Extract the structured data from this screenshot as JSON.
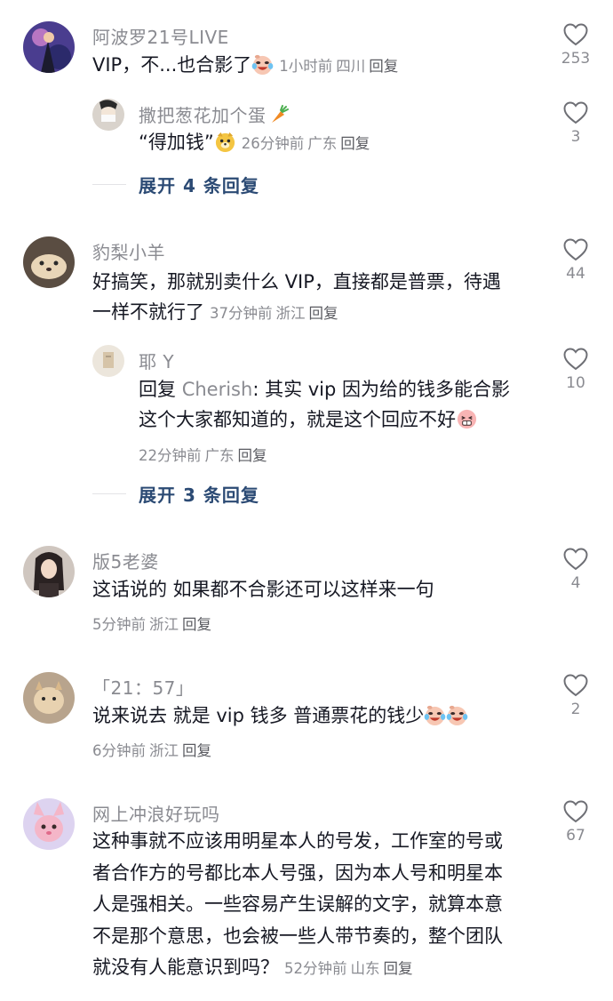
{
  "comments": [
    {
      "username": "阿波罗21号LIVE",
      "text": "VIP，不...也合影了",
      "time": "1小时前",
      "location": "四川",
      "reply_label": "回复",
      "likes": "253",
      "reply": {
        "username": "撒把葱花加个蛋",
        "text": "“得加钱”",
        "time": "26分钟前",
        "location": "广东",
        "reply_label": "回复",
        "likes": "3"
      },
      "expand_label": "展开 4 条回复"
    },
    {
      "username": "豹梨小羊",
      "text_line1": "好搞笑，那就别卖什么 VIP，直接都是普票，待遇",
      "text_line2": "一样不就行了",
      "time": "37分钟前",
      "location": "浙江",
      "reply_label": "回复",
      "likes": "44",
      "reply": {
        "username": "耶 Y",
        "reply_prefix": "回复",
        "reply_target": "Cherish",
        "text_line1": ": 其实 vip 因为给的钱多能合影",
        "text_line2": "这个大家都知道的，就是这个回应不好",
        "time": "22分钟前",
        "location": "广东",
        "reply_label": "回复",
        "likes": "10"
      },
      "expand_label": "展开 3 条回复"
    },
    {
      "username": "版5老婆",
      "text": "这话说的 如果都不合影还可以这样来一句",
      "time": "5分钟前",
      "location": "浙江",
      "reply_label": "回复",
      "likes": "4"
    },
    {
      "username": "「21：57」",
      "text": "说来说去 就是 vip 钱多 普通票花的钱少",
      "time": "6分钟前",
      "location": "浙江",
      "reply_label": "回复",
      "likes": "2"
    },
    {
      "username": "网上冲浪好玩吗",
      "lines": [
        "这种事就不应该用明星本人的号发，工作室的号或",
        "者合作方的号都比本人号强，因为本人号和明星本",
        "人是强相关。一些容易产生误解的文字，就算本意",
        "不是那个意思，也会被一些人带节奏的，整个团队",
        "就没有人能意识到吗？"
      ],
      "time": "52分钟前",
      "location": "山东",
      "reply_label": "回复",
      "likes": "67"
    }
  ],
  "icons": {
    "like": "heart-outline-icon",
    "emoji_laugh_cry": "laughing-crying-face-icon",
    "emoji_doge": "doge-face-icon",
    "emoji_carrot": "carrot-icon",
    "emoji_blush": "embarrassed-face-icon"
  },
  "colors": {
    "text": "#161823",
    "muted": "#8a8b91",
    "expand": "#2b4a74",
    "background": "#ffffff"
  }
}
